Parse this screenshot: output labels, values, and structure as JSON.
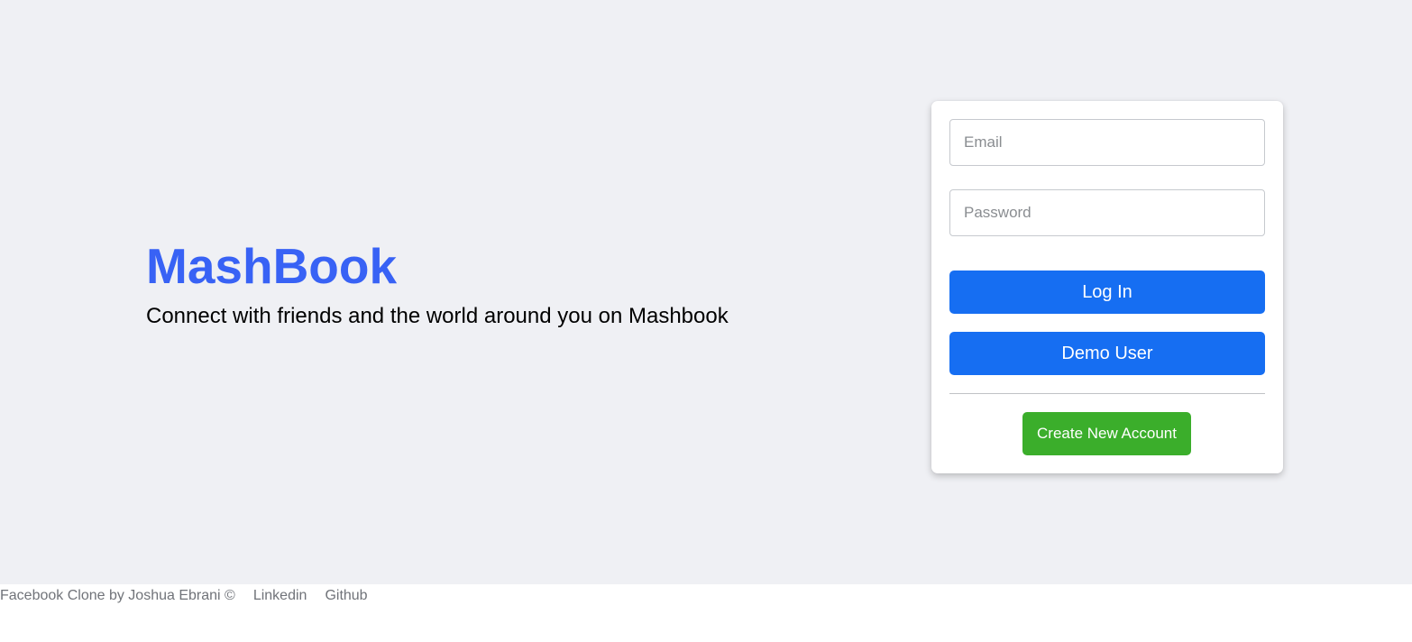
{
  "brand": {
    "title": "MashBook",
    "tagline": "Connect with friends and the world around you on Mashbook"
  },
  "login_form": {
    "email_placeholder": "Email",
    "password_placeholder": "Password",
    "login_label": "Log In",
    "demo_label": "Demo User",
    "create_account_label": "Create New Account"
  },
  "footer": {
    "credit": "Facebook Clone by Joshua Ebrani ©",
    "links": [
      "Linkedin",
      "Github"
    ]
  },
  "colors": {
    "brand": "#3862f5",
    "primary_button": "#166ef2",
    "create_button": "#3bae2b",
    "background": "#eff0f4"
  }
}
